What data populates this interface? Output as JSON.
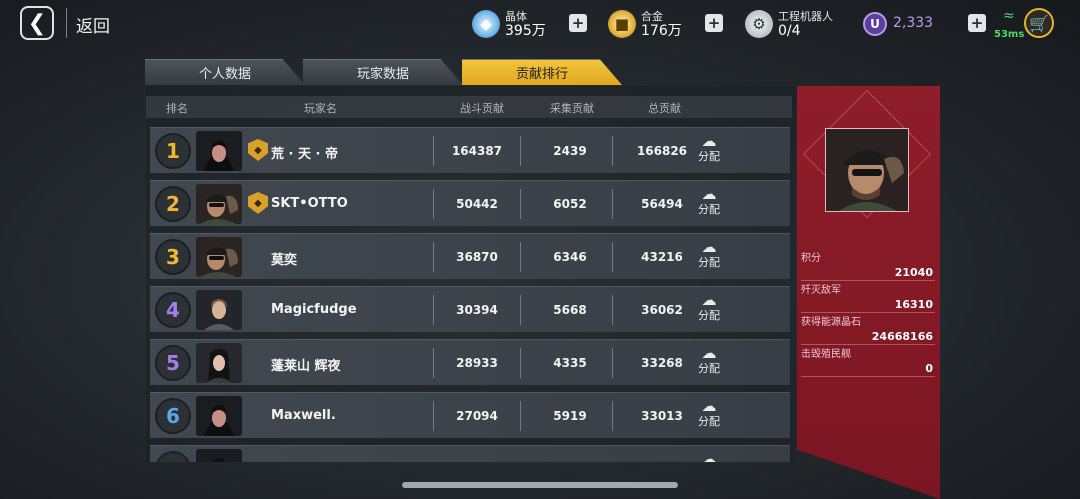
{
  "topbar": {
    "back_label": "返回",
    "crystal": {
      "name": "晶体",
      "value": "395万"
    },
    "alloy": {
      "name": "合金",
      "value": "176万"
    },
    "robot": {
      "name": "工程机器人",
      "value": "0/4"
    },
    "u_currency": "2,333",
    "ping": "53ms"
  },
  "tabs": [
    {
      "label": "个人数据",
      "active": false
    },
    {
      "label": "玩家数据",
      "active": false
    },
    {
      "label": "贡献排行",
      "active": true
    }
  ],
  "table": {
    "headers": {
      "rank": "排名",
      "player": "玩家名",
      "battle": "战斗贡献",
      "gather": "采集贡献",
      "total": "总贡献"
    },
    "distribute_label": "分配",
    "rows": [
      {
        "rank": "1",
        "name": "荒 · 天 · 帝",
        "battle": "164387",
        "gather": "2439",
        "total": "166826",
        "guild": true,
        "rank_color": "#f1b733"
      },
      {
        "rank": "2",
        "name": "SKT•OTTO",
        "battle": "50442",
        "gather": "6052",
        "total": "56494",
        "guild": true,
        "rank_color": "#f1b733"
      },
      {
        "rank": "3",
        "name": "莫奕",
        "battle": "36870",
        "gather": "6346",
        "total": "43216",
        "guild": false,
        "rank_color": "#f1b733"
      },
      {
        "rank": "4",
        "name": "Magicfudge",
        "battle": "30394",
        "gather": "5668",
        "total": "36062",
        "guild": false,
        "rank_color": "#a67de8"
      },
      {
        "rank": "5",
        "name": "蓬莱山 辉夜",
        "battle": "28933",
        "gather": "4335",
        "total": "33268",
        "guild": false,
        "rank_color": "#a67de8"
      },
      {
        "rank": "6",
        "name": "Maxwell.",
        "battle": "27094",
        "gather": "5919",
        "total": "33013",
        "guild": false,
        "rank_color": "#5aa8e8"
      }
    ]
  },
  "panel": {
    "stats": [
      {
        "label": "积分",
        "value": "21040"
      },
      {
        "label": "歼灭敌军",
        "value": "16310"
      },
      {
        "label": "获得能源晶石",
        "value": "24668166"
      },
      {
        "label": "击毁殖民舰",
        "value": "0"
      }
    ]
  },
  "colors": {
    "accent": "#e8b32c",
    "panel": "#8f1d2a",
    "u_currency": "#b99cf2",
    "ping": "#4cd964"
  }
}
